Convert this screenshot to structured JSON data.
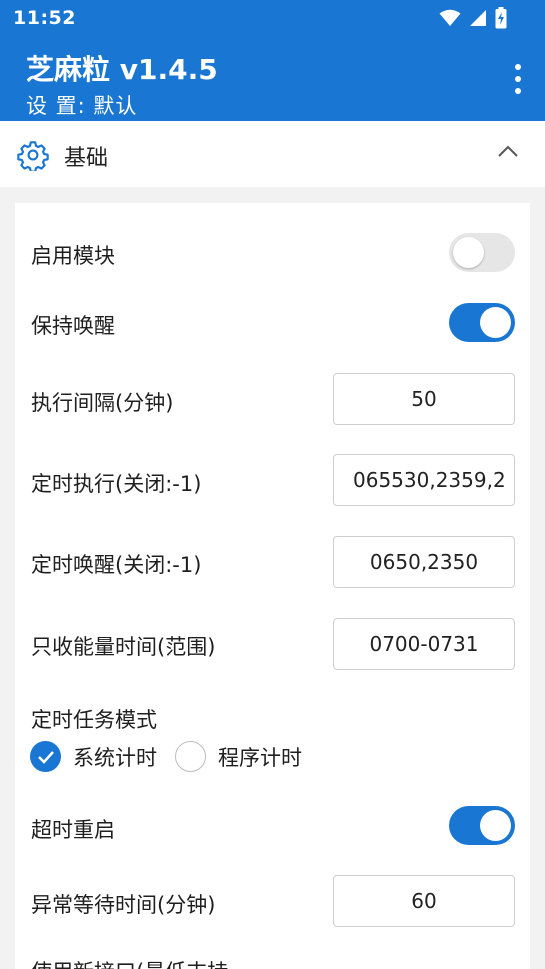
{
  "status_bar": {
    "time": "11:52"
  },
  "app_bar": {
    "title": "芝麻粒 v1.4.5",
    "subtitle": "设 置: 默认"
  },
  "section": {
    "title": "基础"
  },
  "settings": {
    "enable_module": {
      "label": "启用模块",
      "on": false
    },
    "keep_awake": {
      "label": "保持唤醒",
      "on": true
    },
    "exec_interval": {
      "label": "执行间隔(分钟)",
      "value": "50"
    },
    "timed_exec": {
      "label": "定时执行(关闭:-1)",
      "value": "065530,2359,2"
    },
    "timed_wake": {
      "label": "定时唤醒(关闭:-1)",
      "value": "0650,2350"
    },
    "energy_time": {
      "label": "只收能量时间(范围)",
      "value": "0700-0731"
    },
    "task_mode": {
      "label": "定时任务模式",
      "options": [
        "系统计时",
        "程序计时"
      ],
      "selected": "系统计时"
    },
    "timeout_restart": {
      "label": "超时重启",
      "on": true
    },
    "abnormal_wait": {
      "label": "异常等待时间(分钟)",
      "value": "60"
    },
    "partial_label": "使用新接口(最低支持"
  },
  "colors": {
    "primary": "#1976d2",
    "toggle_off": "#e6e6e6"
  }
}
